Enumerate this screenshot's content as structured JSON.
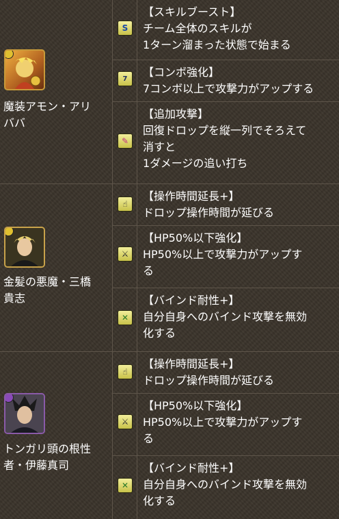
{
  "characters": [
    {
      "name_lines": [
        "魔装アモン・アリ",
        "ババ"
      ],
      "attribute_color": "#e0c030",
      "skills": [
        {
          "icon": "skill-boost-icon",
          "glyph": "S",
          "lines": [
            "【スキルブースト】",
            "チーム全体のスキルが",
            "1ターン溜まった状態で始まる"
          ]
        },
        {
          "icon": "combo-boost-icon",
          "glyph": "7",
          "lines": [
            "【コンボ強化】",
            "7コンボ以上で攻撃力がアップする"
          ]
        },
        {
          "icon": "additional-attack-icon",
          "glyph": "✎",
          "lines": [
            "【追加攻撃】",
            "回復ドロップを縦一列でそろえて",
            "消すと",
            "1ダメージの追い打ち"
          ]
        }
      ]
    },
    {
      "name_lines": [
        "金髪の悪魔・三橋",
        "貴志"
      ],
      "attribute_color": "#e0c030",
      "skills": [
        {
          "icon": "extend-time-icon",
          "glyph": "☝",
          "lines": [
            "【操作時間延長+】",
            "ドロップ操作時間が延びる"
          ]
        },
        {
          "icon": "hp-boost-icon",
          "glyph": "⚔",
          "lines": [
            "【HP50%以下強化】",
            "HP50%以上で攻撃力がアップす",
            "る"
          ]
        },
        {
          "icon": "bind-resist-icon",
          "glyph": "✕",
          "lines": [
            "【バインド耐性+】",
            "自分自身へのバインド攻撃を無効",
            "化する"
          ]
        }
      ]
    },
    {
      "name_lines": [
        "トンガリ頭の根性",
        "者・伊藤真司"
      ],
      "attribute_color": "#8a4ab8",
      "skills": [
        {
          "icon": "extend-time-icon",
          "glyph": "☝",
          "lines": [
            "【操作時間延長+】",
            "ドロップ操作時間が延びる"
          ]
        },
        {
          "icon": "hp-boost-icon",
          "glyph": "⚔",
          "lines": [
            "【HP50%以下強化】",
            "HP50%以上で攻撃力がアップす",
            "る"
          ]
        },
        {
          "icon": "bind-resist-icon",
          "glyph": "✕",
          "lines": [
            "【バインド耐性+】",
            "自分自身へのバインド攻撃を無効",
            "化する"
          ]
        }
      ]
    }
  ]
}
